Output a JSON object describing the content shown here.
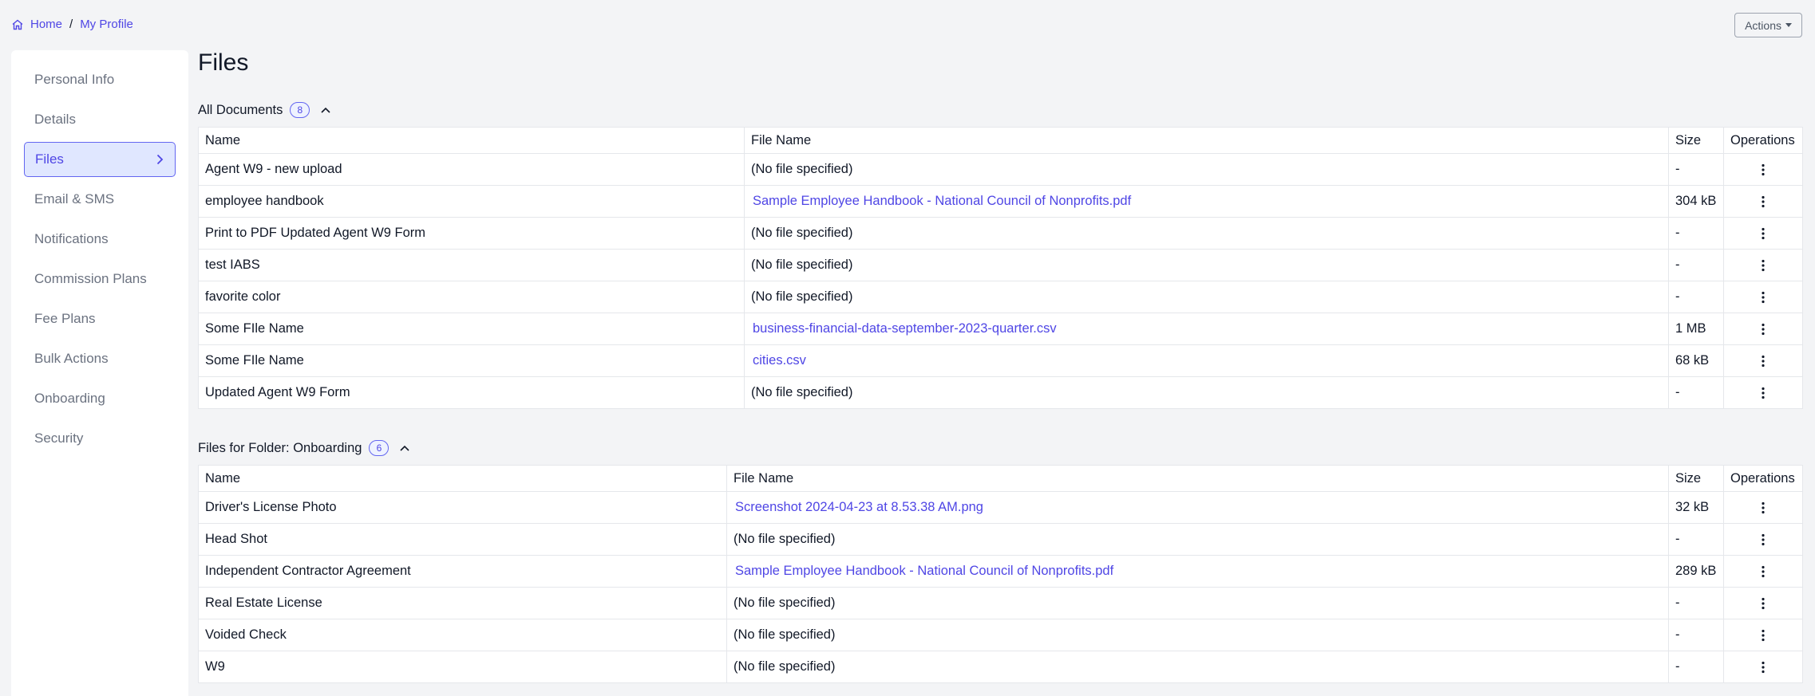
{
  "breadcrumb": {
    "home": "Home",
    "separator": "/",
    "current": "My Profile"
  },
  "actions": {
    "label": "Actions"
  },
  "sidebar": {
    "items": [
      {
        "label": "Personal Info",
        "active": false
      },
      {
        "label": "Details",
        "active": false
      },
      {
        "label": "Files",
        "active": true
      },
      {
        "label": "Email & SMS",
        "active": false
      },
      {
        "label": "Notifications",
        "active": false
      },
      {
        "label": "Commission Plans",
        "active": false
      },
      {
        "label": "Fee Plans",
        "active": false
      },
      {
        "label": "Bulk Actions",
        "active": false
      },
      {
        "label": "Onboarding",
        "active": false
      },
      {
        "label": "Security",
        "active": false
      }
    ]
  },
  "page": {
    "title": "Files"
  },
  "sections": [
    {
      "title": "All Documents",
      "count": "8",
      "columns": [
        "Name",
        "File Name",
        "Size",
        "Operations"
      ],
      "rows": [
        {
          "name": "Agent W9 - new upload",
          "file": "(No file specified)",
          "is_link": false,
          "size": "-"
        },
        {
          "name": "employee handbook",
          "file": "Sample Employee Handbook - National Council of Nonprofits.pdf",
          "is_link": true,
          "size": "304 kB"
        },
        {
          "name": "Print to PDF Updated Agent W9 Form",
          "file": "(No file specified)",
          "is_link": false,
          "size": "-"
        },
        {
          "name": "test IABS",
          "file": "(No file specified)",
          "is_link": false,
          "size": "-"
        },
        {
          "name": "favorite color",
          "file": "(No file specified)",
          "is_link": false,
          "size": "-"
        },
        {
          "name": "Some FIle Name",
          "file": "business-financial-data-september-2023-quarter.csv",
          "is_link": true,
          "size": "1 MB"
        },
        {
          "name": "Some FIle Name",
          "file": "cities.csv",
          "is_link": true,
          "size": "68 kB"
        },
        {
          "name": "Updated Agent W9 Form",
          "file": "(No file specified)",
          "is_link": false,
          "size": "-"
        }
      ]
    },
    {
      "title": "Files for Folder: Onboarding",
      "count": "6",
      "columns": [
        "Name",
        "File Name",
        "Size",
        "Operations"
      ],
      "rows": [
        {
          "name": "Driver's License Photo",
          "file": "Screenshot 2024-04-23 at 8.53.38 AM.png",
          "is_link": true,
          "size": "32 kB"
        },
        {
          "name": "Head Shot",
          "file": "(No file specified)",
          "is_link": false,
          "size": "-"
        },
        {
          "name": "Independent Contractor Agreement",
          "file": "Sample Employee Handbook - National Council of Nonprofits.pdf",
          "is_link": true,
          "size": "289 kB"
        },
        {
          "name": "Real Estate License",
          "file": "(No file specified)",
          "is_link": false,
          "size": "-"
        },
        {
          "name": "Voided Check",
          "file": "(No file specified)",
          "is_link": false,
          "size": "-"
        },
        {
          "name": "W9",
          "file": "(No file specified)",
          "is_link": false,
          "size": "-"
        }
      ]
    }
  ],
  "icons": {
    "home": "home-icon",
    "chevron": "chevron-right-icon",
    "collapse": "chevron-up-icon",
    "operations": "kebab-menu-icon"
  },
  "colors": {
    "accent": "#4f46e5",
    "background": "#f3f4f6",
    "active_bg": "#e0e7ff"
  }
}
